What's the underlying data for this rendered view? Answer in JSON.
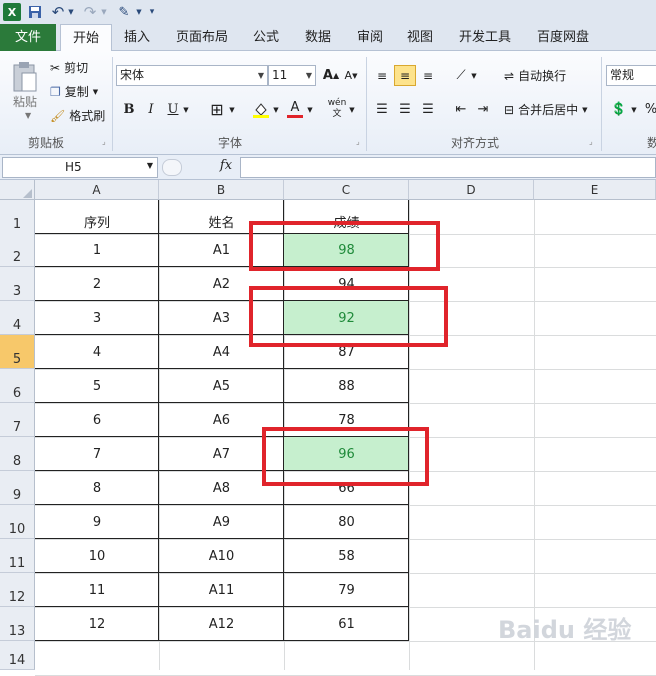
{
  "quick_access": {
    "app_icon": "excel-icon",
    "save_icon": "save-icon",
    "undo_icon": "undo-icon",
    "redo_icon": "redo-icon"
  },
  "tabs": [
    "文件",
    "开始",
    "插入",
    "页面布局",
    "公式",
    "数据",
    "审阅",
    "视图",
    "开发工具",
    "百度网盘"
  ],
  "ribbon": {
    "clipboard": {
      "paste": "粘贴",
      "cut": "剪切",
      "copy": "复制",
      "format_painter": "格式刷",
      "label": "剪贴板"
    },
    "font": {
      "name": "宋体",
      "size": "11",
      "bold": "B",
      "italic": "I",
      "underline": "U",
      "label": "字体",
      "grow": "A",
      "shrink": "A",
      "color_a": "A",
      "phonetic": "wén"
    },
    "alignment": {
      "wrap": "自动换行",
      "merge": "合并后居中",
      "label": "对齐方式"
    },
    "number": {
      "format": "常规",
      "percent": "%",
      "label_partial": "数"
    }
  },
  "formula_bar": {
    "name_box": "H5",
    "fx": "fx",
    "value": ""
  },
  "columns": [
    "A",
    "B",
    "C",
    "D",
    "E"
  ],
  "rows": [
    "1",
    "2",
    "3",
    "4",
    "5",
    "6",
    "7",
    "8",
    "9",
    "10",
    "11",
    "12",
    "13",
    "14"
  ],
  "selected_row": "5",
  "table": {
    "headers": [
      "序列",
      "姓名",
      "成绩"
    ],
    "rows": [
      [
        "1",
        "A1",
        "98"
      ],
      [
        "2",
        "A2",
        "94"
      ],
      [
        "3",
        "A3",
        "92"
      ],
      [
        "4",
        "A4",
        "87"
      ],
      [
        "5",
        "A5",
        "88"
      ],
      [
        "6",
        "A6",
        "78"
      ],
      [
        "7",
        "A7",
        "96"
      ],
      [
        "8",
        "A8",
        "66"
      ],
      [
        "9",
        "A9",
        "80"
      ],
      [
        "10",
        "A10",
        "58"
      ],
      [
        "11",
        "A11",
        "79"
      ],
      [
        "12",
        "A12",
        "61"
      ]
    ],
    "highlighted_rows": [
      0,
      2,
      6
    ]
  },
  "colors": {
    "highlight_fill": "#c6efce",
    "highlight_text": "#1f8a3a",
    "annotation": "#e0242b",
    "file_tab": "#2b7a3a"
  },
  "watermark": "Baidu 经验"
}
